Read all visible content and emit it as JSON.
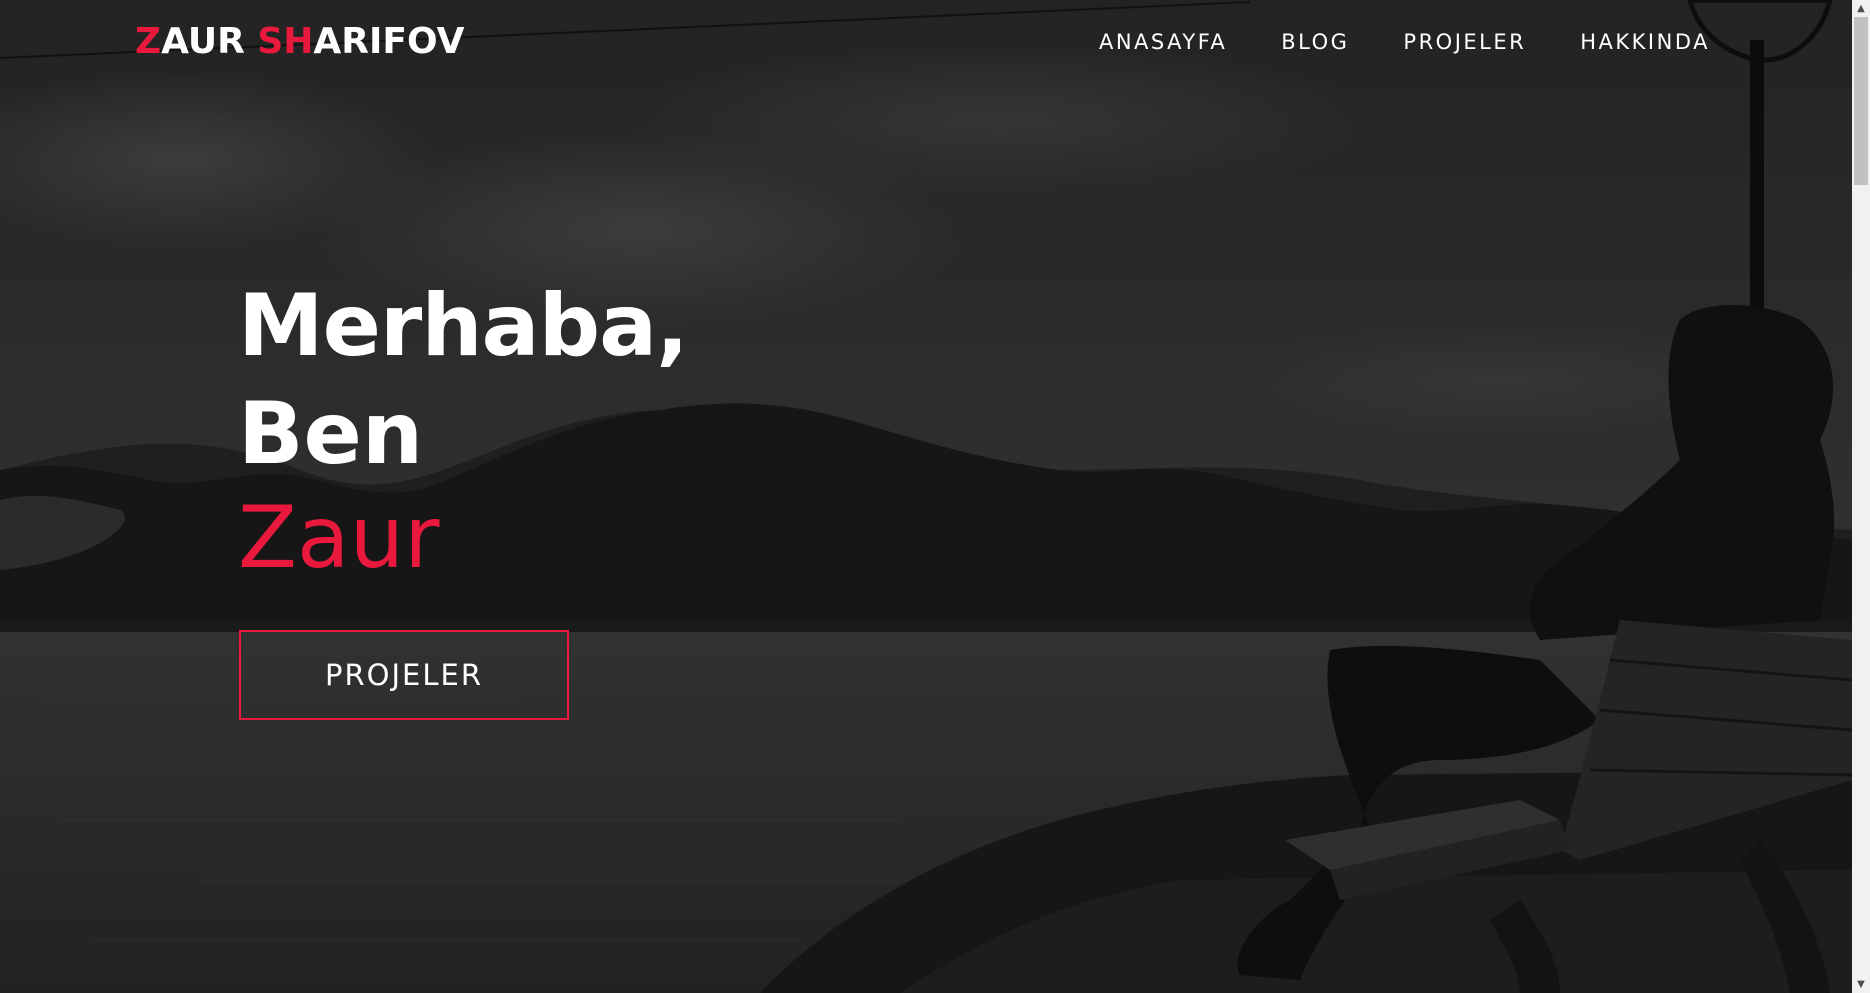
{
  "brand": {
    "logo_first_initial": "Z",
    "logo_first_rest": "AUR ",
    "logo_last_initials": "SH",
    "logo_last_rest": "ARIFOV"
  },
  "nav": {
    "items": [
      {
        "label": "ANASAYFA"
      },
      {
        "label": "BLOG"
      },
      {
        "label": "PROJELER"
      },
      {
        "label": "HAKKINDA"
      }
    ]
  },
  "hero": {
    "line1": "Merhaba,",
    "line2": "Ben",
    "name": "Zaur",
    "button_label": "PROJELER"
  },
  "colors": {
    "accent": "#e8193c",
    "text": "#ffffff",
    "overlay": "#1e1e1e"
  },
  "background": {
    "description_icon": "lake-landscape-photo"
  }
}
